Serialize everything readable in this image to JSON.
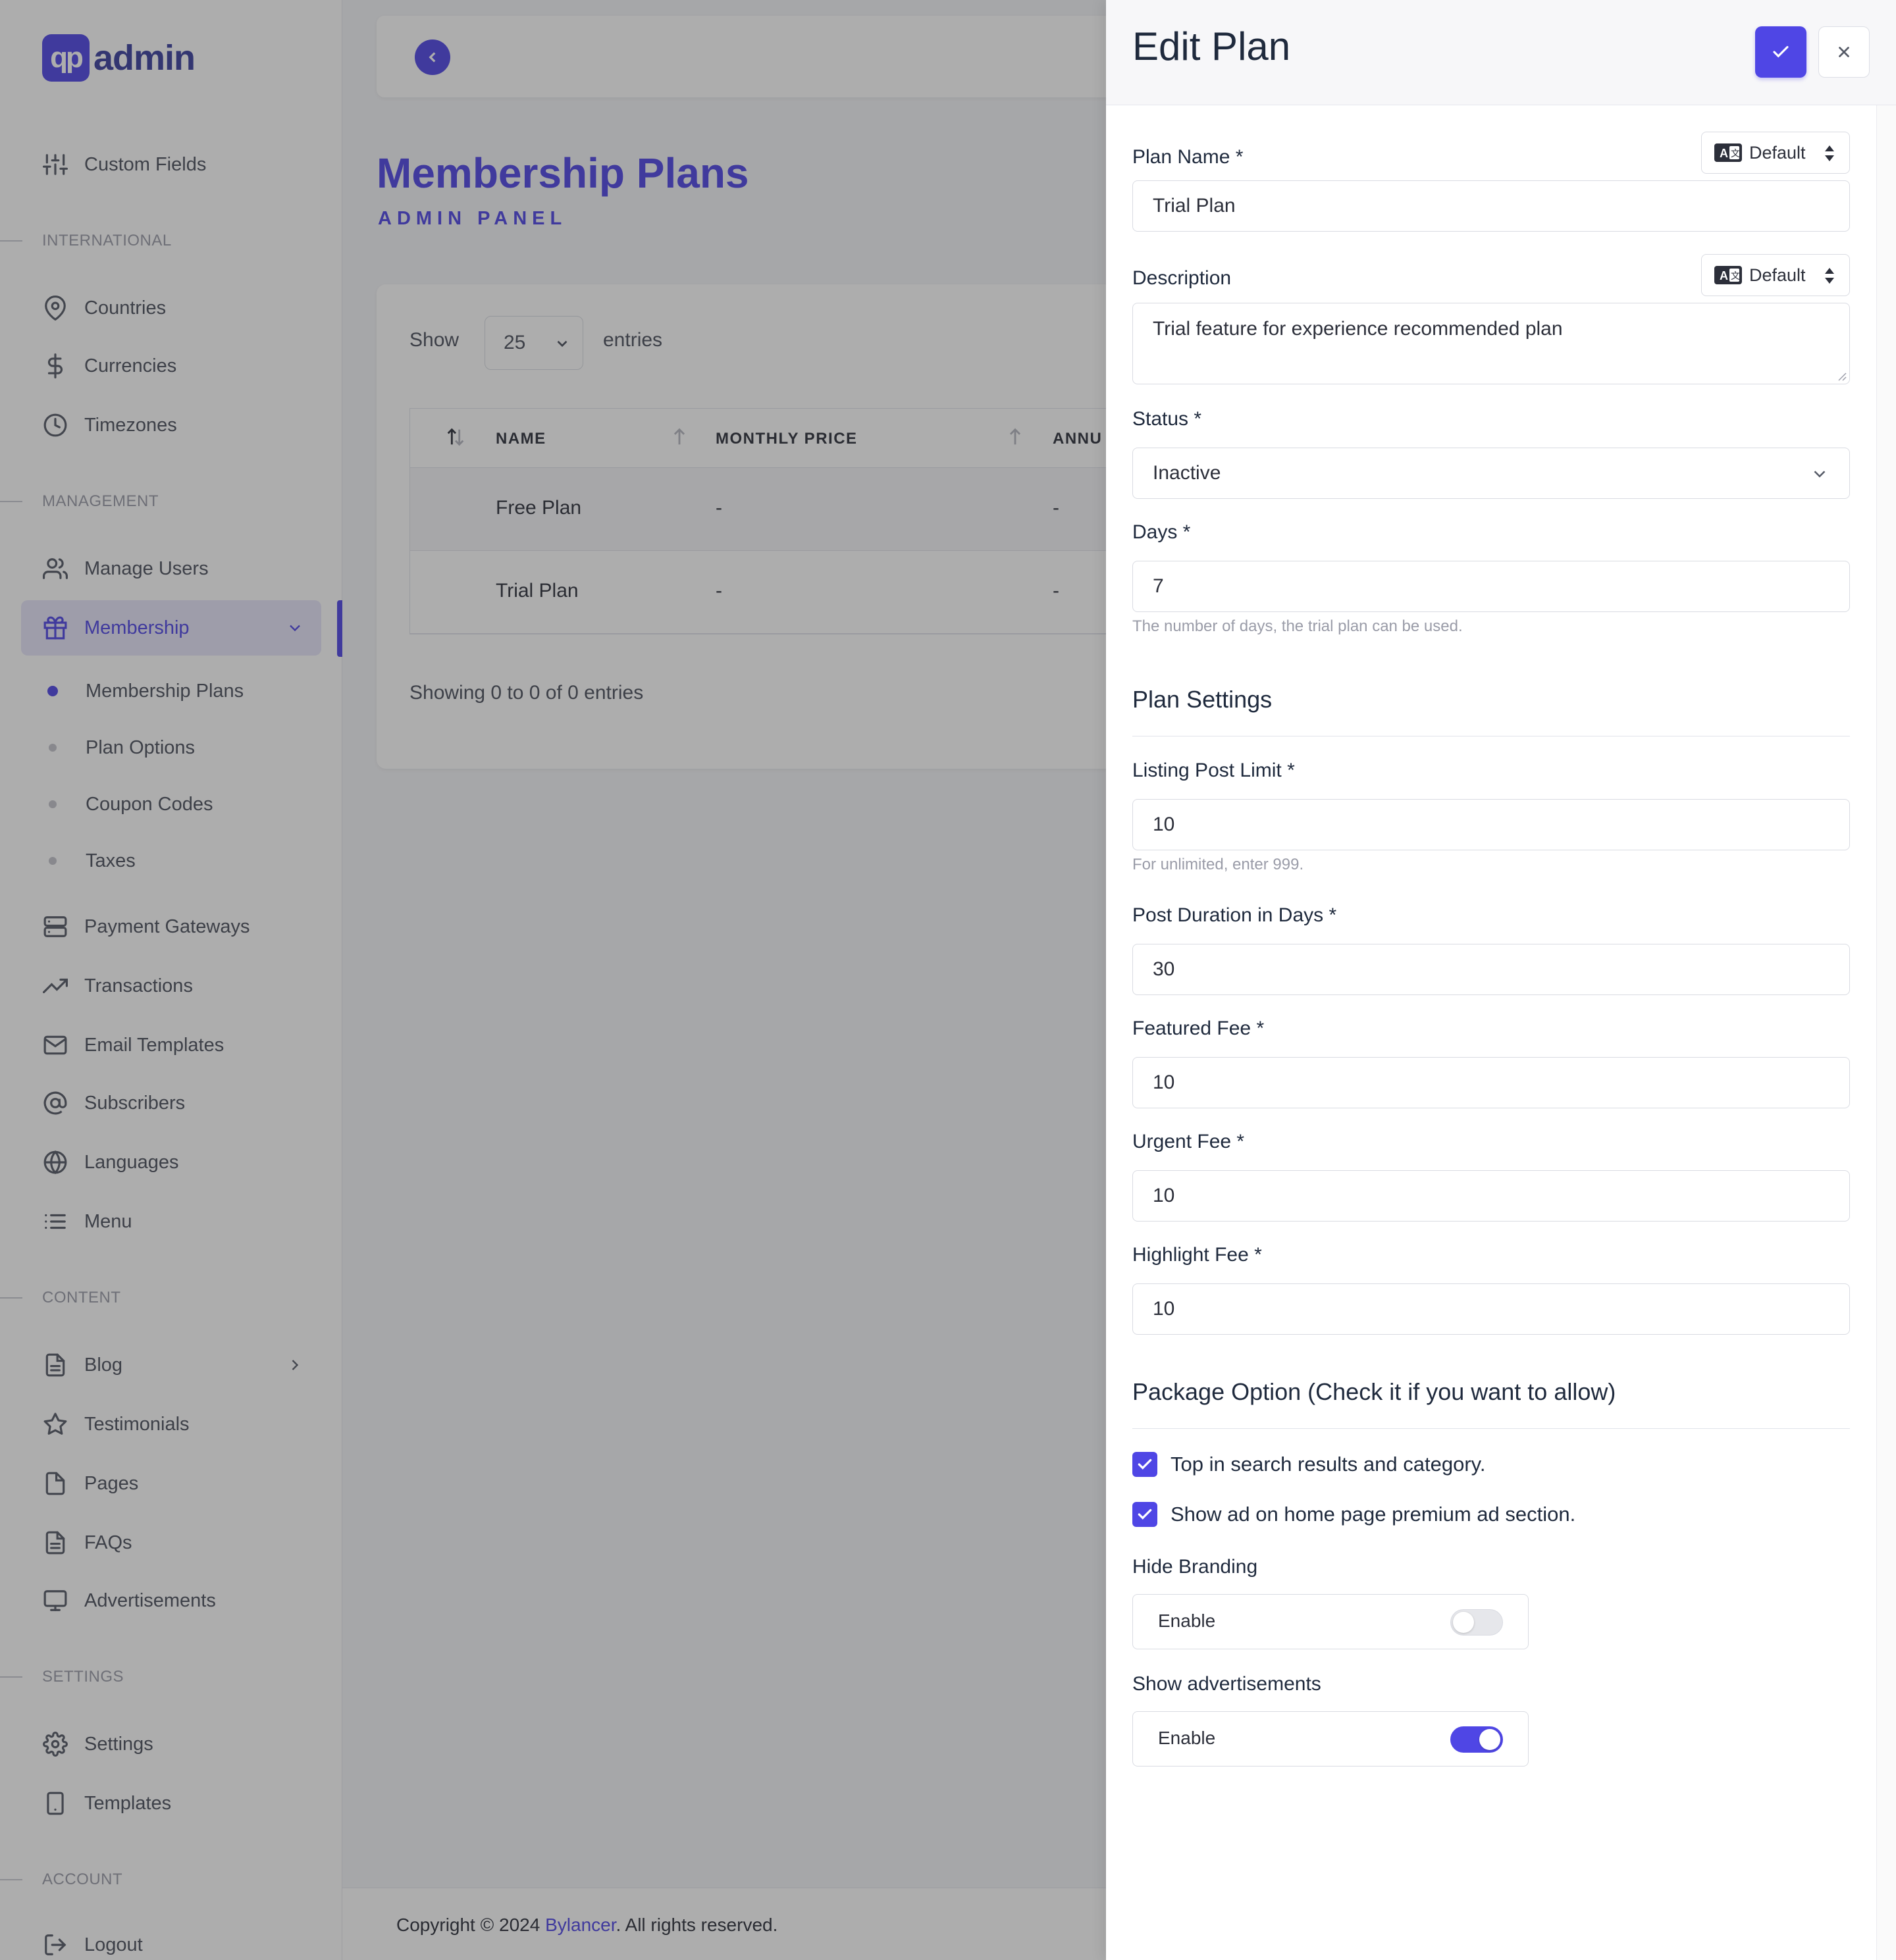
{
  "logo": {
    "mark": "qp",
    "text": "admin"
  },
  "sidebar": {
    "top_items": [
      {
        "label": "Custom Fields",
        "icon": "sliders-icon"
      }
    ],
    "sections": {
      "international": "INTERNATIONAL",
      "management": "MANAGEMENT",
      "content": "CONTENT",
      "settings": "SETTINGS",
      "account": "ACCOUNT"
    },
    "international": [
      {
        "label": "Countries",
        "icon": "map-pin-icon"
      },
      {
        "label": "Currencies",
        "icon": "dollar-icon"
      },
      {
        "label": "Timezones",
        "icon": "clock-icon"
      }
    ],
    "management": [
      {
        "label": "Manage Users",
        "icon": "users-icon"
      },
      {
        "label": "Membership",
        "icon": "gift-icon"
      }
    ],
    "membership_sub": [
      "Membership Plans",
      "Plan Options",
      "Coupon Codes",
      "Taxes"
    ],
    "management_more": [
      {
        "label": "Payment Gateways",
        "icon": "server-icon"
      },
      {
        "label": "Transactions",
        "icon": "trending-up-icon"
      },
      {
        "label": "Email Templates",
        "icon": "mail-icon"
      },
      {
        "label": "Subscribers",
        "icon": "at-sign-icon"
      },
      {
        "label": "Languages",
        "icon": "globe-icon"
      },
      {
        "label": "Menu",
        "icon": "list-icon"
      }
    ],
    "content": [
      {
        "label": "Blog",
        "icon": "file-text-icon"
      },
      {
        "label": "Testimonials",
        "icon": "star-icon"
      },
      {
        "label": "Pages",
        "icon": "file-icon"
      },
      {
        "label": "FAQs",
        "icon": "file-text-icon"
      },
      {
        "label": "Advertisements",
        "icon": "monitor-icon"
      }
    ],
    "settings": [
      {
        "label": "Settings",
        "icon": "gear-icon"
      },
      {
        "label": "Templates",
        "icon": "tablet-icon"
      }
    ],
    "account": [
      {
        "label": "Logout",
        "icon": "logout-icon"
      }
    ]
  },
  "page": {
    "title": "Membership Plans",
    "subtitle": "ADMIN PANEL"
  },
  "table_controls": {
    "show": "Show",
    "entries_value": "25",
    "entries": "entries",
    "showing": "Showing 0 to 0 of 0 entries"
  },
  "table": {
    "headers": [
      "NAME",
      "MONTHLY PRICE",
      "ANNU"
    ],
    "rows": [
      {
        "name": "Free Plan",
        "monthly": "-",
        "annual": "-"
      },
      {
        "name": "Trial Plan",
        "monthly": "-",
        "annual": "-"
      }
    ]
  },
  "footer": {
    "prefix": "Copyright © 2024 ",
    "brand": "Bylancer",
    "suffix": ". All rights reserved."
  },
  "panel": {
    "title": "Edit Plan",
    "lang_default": "Default",
    "plan_name_label": "Plan Name *",
    "plan_name_value": "Trial Plan",
    "description_label": "Description",
    "description_value": "Trial feature for experience recommended plan",
    "status_label": "Status *",
    "status_value": "Inactive",
    "days_label": "Days *",
    "days_value": "7",
    "days_hint": "The number of days, the trial plan can be used.",
    "plan_settings_title": "Plan Settings",
    "listing_limit_label": "Listing Post Limit *",
    "listing_limit_value": "10",
    "listing_limit_hint": "For unlimited, enter 999.",
    "post_duration_label": "Post Duration in Days *",
    "post_duration_value": "30",
    "featured_fee_label": "Featured Fee *",
    "featured_fee_value": "10",
    "urgent_fee_label": "Urgent Fee *",
    "urgent_fee_value": "10",
    "highlight_fee_label": "Highlight Fee *",
    "highlight_fee_value": "10",
    "package_title": "Package Option (Check it if you want to allow)",
    "check_top": "Top in search results and category.",
    "check_home": "Show ad on home page premium ad section.",
    "hide_branding_label": "Hide Branding",
    "show_ads_label": "Show advertisements",
    "enable": "Enable",
    "hide_branding_on": false,
    "show_ads_on": true
  },
  "colors": {
    "accent": "#4f46e5",
    "text": "#2c2f3a",
    "muted": "#9a9ca8"
  }
}
